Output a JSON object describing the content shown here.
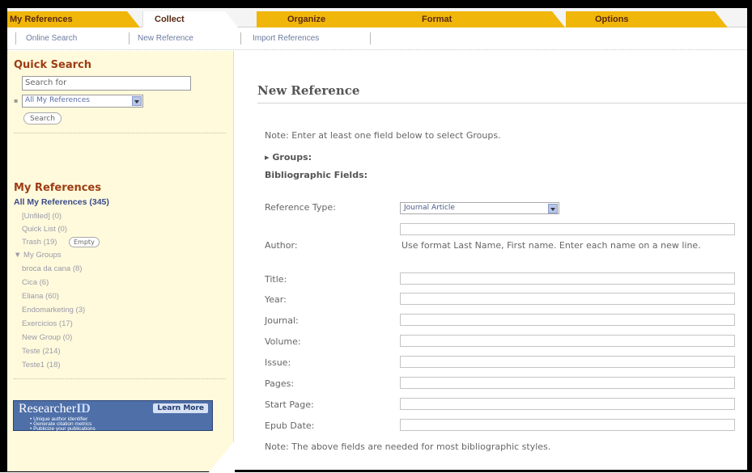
{
  "tabs": [
    {
      "label": "My References",
      "active": false
    },
    {
      "label": "Collect",
      "active": true
    },
    {
      "label": "Organize",
      "active": false
    },
    {
      "label": "Format",
      "active": false
    },
    {
      "label": "Options",
      "active": false
    }
  ],
  "subnav": [
    "Online Search",
    "New Reference",
    "Import References"
  ],
  "sidebar": {
    "quick_search_heading": "Quick Search",
    "search_placeholder": "Search for",
    "scope_select": "All My References",
    "search_button": "Search",
    "my_references_heading": "My References",
    "all_refs": "All My References (345)",
    "unfiled": "[Unfiled] (0)",
    "quick_list": "Quick List (0)",
    "trash": "Trash (19)",
    "empty_button": "Empty",
    "my_groups": "My Groups",
    "groups": [
      "broca da cana (8)",
      "Cica (6)",
      "Eliana (60)",
      "Endomarketing (3)",
      "Exercicios (17)",
      "New Group (0)",
      "Teste (214)",
      "Teste1 (18)"
    ],
    "researcherid": {
      "title_a": "Researcher",
      "title_b": "ID",
      "learn_more": "Learn More",
      "items": [
        "Unique author identifier",
        "Generate citation metrics",
        "Publicize your publications"
      ]
    }
  },
  "main": {
    "title": "New Reference",
    "note_top": "Note: Enter at least one field below to select Groups.",
    "groups_label": "Groups:",
    "bib_fields": "Bibliographic Fields:",
    "reference_type_label": "Reference Type:",
    "reference_type_value": "Journal Article",
    "author_label": "Author:",
    "author_hint": "Use format Last Name, First name. Enter each name on a new line.",
    "fields": [
      "Title:",
      "Year:",
      "Journal:",
      "Volume:",
      "Issue:",
      "Pages:",
      "Start Page:",
      "Epub Date:"
    ],
    "note_bottom": "Note: The above fields are needed for most bibliographic styles."
  },
  "colors": {
    "tab_gold": "#f0b60a",
    "tab_text": "#5a2a14",
    "sidebar_bg": "#fffadc",
    "heading_rust": "#9c3d14",
    "link_blue": "#6c7ba0",
    "researcherid_blue": "#4e6fa8"
  }
}
